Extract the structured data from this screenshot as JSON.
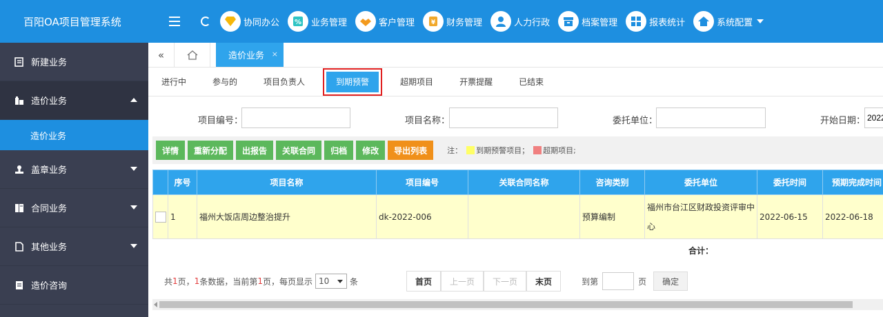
{
  "app": {
    "title": "百阳OA项目管理系统"
  },
  "colors": {
    "primary": "#1e8fe0",
    "tab_active": "#2fa4ec",
    "sidebar_bg": "#3a3f51",
    "btn_green": "#5cb85c",
    "btn_orange": "#f0901a",
    "warn_yellow": "#ffff66",
    "overdue_red": "#f08080",
    "active_outline": "#e02020"
  },
  "sidebar": {
    "items": [
      {
        "label": "新建业务",
        "icon": "edit-icon"
      },
      {
        "label": "造价业务",
        "icon": "building-icon"
      },
      {
        "label": "造价业务",
        "icon": ""
      },
      {
        "label": "盖章业务",
        "icon": "stamp-icon"
      },
      {
        "label": "合同业务",
        "icon": "contract-icon"
      },
      {
        "label": "其他业务",
        "icon": "document-icon"
      },
      {
        "label": "造价咨询",
        "icon": "consult-icon"
      }
    ]
  },
  "topnav": {
    "menus": [
      {
        "label": "协同办公",
        "icon": "diamond-icon"
      },
      {
        "label": "业务管理",
        "icon": "percent-icon"
      },
      {
        "label": "客户管理",
        "icon": "handshake-icon"
      },
      {
        "label": "财务管理",
        "icon": "wallet-icon"
      },
      {
        "label": "人力行政",
        "icon": "person-icon"
      },
      {
        "label": "档案管理",
        "icon": "archive-icon"
      },
      {
        "label": "报表统计",
        "icon": "grid-icon"
      },
      {
        "label": "系统配置",
        "icon": "home-icon"
      }
    ]
  },
  "tabstrip": {
    "open_tab": "造价业务",
    "close_glyph": "×"
  },
  "subtabs": [
    "进行中",
    "参与的",
    "项目负责人",
    "到期预警",
    "超期项目",
    "开票提醒",
    "已结束"
  ],
  "search": {
    "project_no_label": "项目编号：",
    "project_name_label": "项目名称：",
    "client_label": "委托单位：",
    "start_date_label": "开始日期：",
    "start_date_value": "2022"
  },
  "toolbar": {
    "buttons": [
      "详情",
      "重新分配",
      "出报告",
      "关联合同",
      "归档",
      "修改",
      "导出列表"
    ],
    "note_prefix": "注：",
    "note_warn": "到期预警项目；",
    "note_overdue": "超期项目;"
  },
  "table": {
    "headers": [
      "序号",
      "项目名称",
      "项目编号",
      "关联合同名称",
      "咨询类别",
      "委托单位",
      "委托时间",
      "预期完成时间"
    ],
    "rows": [
      {
        "index": "1",
        "name": "福州大饭店周边整治提升",
        "code": "dk-2022-006",
        "contract": "",
        "category": "预算编制",
        "client": "福州市台江区财政投资评审中心",
        "entrust_date": "2022-06-15",
        "expected_date": "2022-06-18"
      }
    ],
    "total_label": "合计："
  },
  "pager": {
    "prefix": "共",
    "total_pages": "1",
    "pages_suffix": "页，",
    "total_records": "1",
    "records_suffix": "条数据，当前第",
    "current_page": "1",
    "current_suffix": "页，每页显示",
    "page_size": "10",
    "size_suffix": "条",
    "first": "首页",
    "prev": "上一页",
    "next": "下一页",
    "last": "末页",
    "goto_prefix": "到第",
    "goto_suffix": "页",
    "confirm": "确定"
  }
}
